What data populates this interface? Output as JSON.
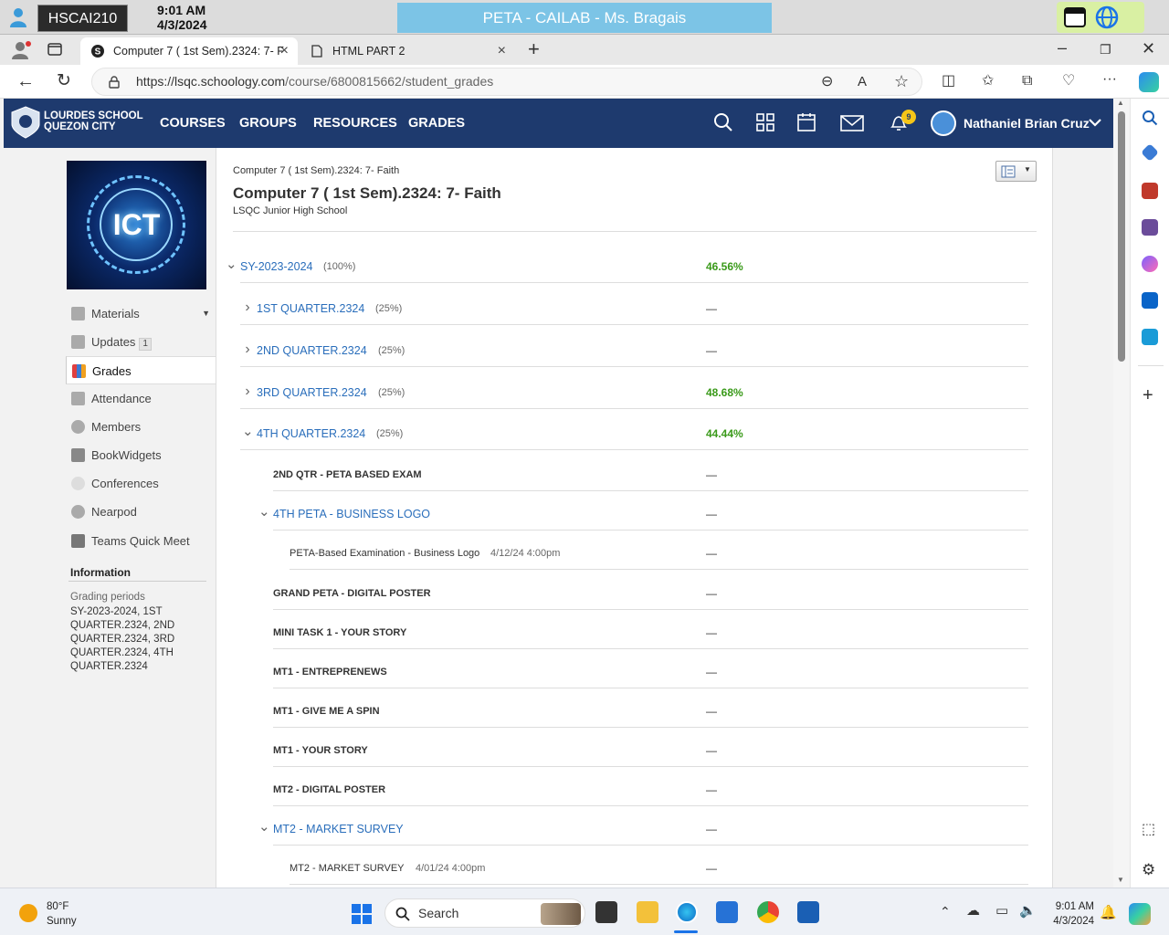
{
  "kiosk": {
    "host": "HSCAI210",
    "time": "9:01 AM",
    "date": "4/3/2024",
    "session": "PETA - CAILAB - Ms. Bragais"
  },
  "tabs": [
    {
      "label": "Computer 7 ( 1st Sem).2324: 7- F",
      "icon": "schoology-icon",
      "active": true
    },
    {
      "label": "HTML PART 2",
      "icon": "document-icon",
      "active": false
    }
  ],
  "address": {
    "host": "https://lsqc.schoology.com",
    "path": "/course/6800815662/student_grades"
  },
  "nav": {
    "school_line1": "LOURDES SCHOOL",
    "school_line2": "QUEZON CITY",
    "menu": [
      "COURSES",
      "GROUPS",
      "RESOURCES",
      "GRADES"
    ],
    "notifications": "9",
    "user": "Nathaniel Brian Cruz"
  },
  "sidebar": {
    "course_image_text": "ICT",
    "items": [
      {
        "label": "Materials",
        "icon": "materials-icon"
      },
      {
        "label": "Updates",
        "icon": "updates-icon",
        "count": "1"
      },
      {
        "label": "Grades",
        "icon": "grades-icon"
      },
      {
        "label": "Attendance",
        "icon": "attendance-icon"
      },
      {
        "label": "Members",
        "icon": "members-icon"
      },
      {
        "label": "BookWidgets",
        "icon": "bookwidgets-icon"
      },
      {
        "label": "Conferences",
        "icon": "conferences-icon"
      },
      {
        "label": "Nearpod",
        "icon": "nearpod-icon"
      },
      {
        "label": "Teams Quick Meet",
        "icon": "teams-icon"
      }
    ],
    "info_heading": "Information",
    "grading_periods_label": "Grading periods",
    "grading_periods_value": "SY-2023-2024, 1ST QUARTER.2324, 2ND QUARTER.2324, 3RD QUARTER.2324, 4TH QUARTER.2324"
  },
  "course": {
    "breadcrumb": "Computer 7 ( 1st Sem).2324: 7- Faith",
    "title": "Computer 7 ( 1st Sem).2324: 7- Faith",
    "school": "LSQC Junior High School"
  },
  "grades": [
    {
      "name": "SY-2023-2024",
      "weight": "(100%)",
      "grade": "46.56%",
      "level": 0,
      "chevron": "down",
      "kind": "link",
      "green": true
    },
    {
      "name": "1ST QUARTER.2324",
      "weight": "(25%)",
      "grade": "—",
      "level": 1,
      "chevron": "right",
      "kind": "link"
    },
    {
      "name": "2ND QUARTER.2324",
      "weight": "(25%)",
      "grade": "—",
      "level": 1,
      "chevron": "right",
      "kind": "link"
    },
    {
      "name": "3RD QUARTER.2324",
      "weight": "(25%)",
      "grade": "48.68%",
      "level": 1,
      "chevron": "right",
      "kind": "link",
      "green": true
    },
    {
      "name": "4TH QUARTER.2324",
      "weight": "(25%)",
      "grade": "44.44%",
      "level": 1,
      "chevron": "down",
      "kind": "link",
      "green": true
    },
    {
      "name": "2ND QTR - PETA BASED EXAM",
      "grade": "—",
      "level": 2,
      "kind": "item"
    },
    {
      "name": "4TH PETA - BUSINESS LOGO",
      "grade": "—",
      "level": 2,
      "chevron": "down",
      "kind": "link"
    },
    {
      "name": "PETA-Based Examination - Business Logo",
      "date": "4/12/24 4:00pm",
      "grade": "—",
      "level": 3,
      "kind": "sub"
    },
    {
      "name": "GRAND PETA - DIGITAL POSTER",
      "grade": "—",
      "level": 2,
      "kind": "item"
    },
    {
      "name": "MINI TASK 1 - YOUR STORY",
      "grade": "—",
      "level": 2,
      "kind": "item"
    },
    {
      "name": "MT1 - ENTREPRENEWS",
      "grade": "—",
      "level": 2,
      "kind": "item"
    },
    {
      "name": "MT1 - GIVE ME A SPIN",
      "grade": "—",
      "level": 2,
      "kind": "item"
    },
    {
      "name": "MT1 - YOUR STORY",
      "grade": "—",
      "level": 2,
      "kind": "item"
    },
    {
      "name": "MT2 - DIGITAL POSTER",
      "grade": "—",
      "level": 2,
      "kind": "item"
    },
    {
      "name": "MT2 - MARKET SURVEY",
      "grade": "—",
      "level": 2,
      "chevron": "down",
      "kind": "link"
    },
    {
      "name": "MT2 - MARKET SURVEY",
      "date": "4/01/24 4:00pm",
      "grade": "—",
      "level": 3,
      "kind": "sub"
    }
  ],
  "taskbar": {
    "temp": "80°F",
    "condition": "Sunny",
    "search": "Search",
    "time": "9:01 AM",
    "date": "4/3/2024"
  },
  "colors": {
    "nav_bg": "#1e3a6e",
    "link": "#2a6ebb",
    "grade_green": "#3a9a1a"
  }
}
